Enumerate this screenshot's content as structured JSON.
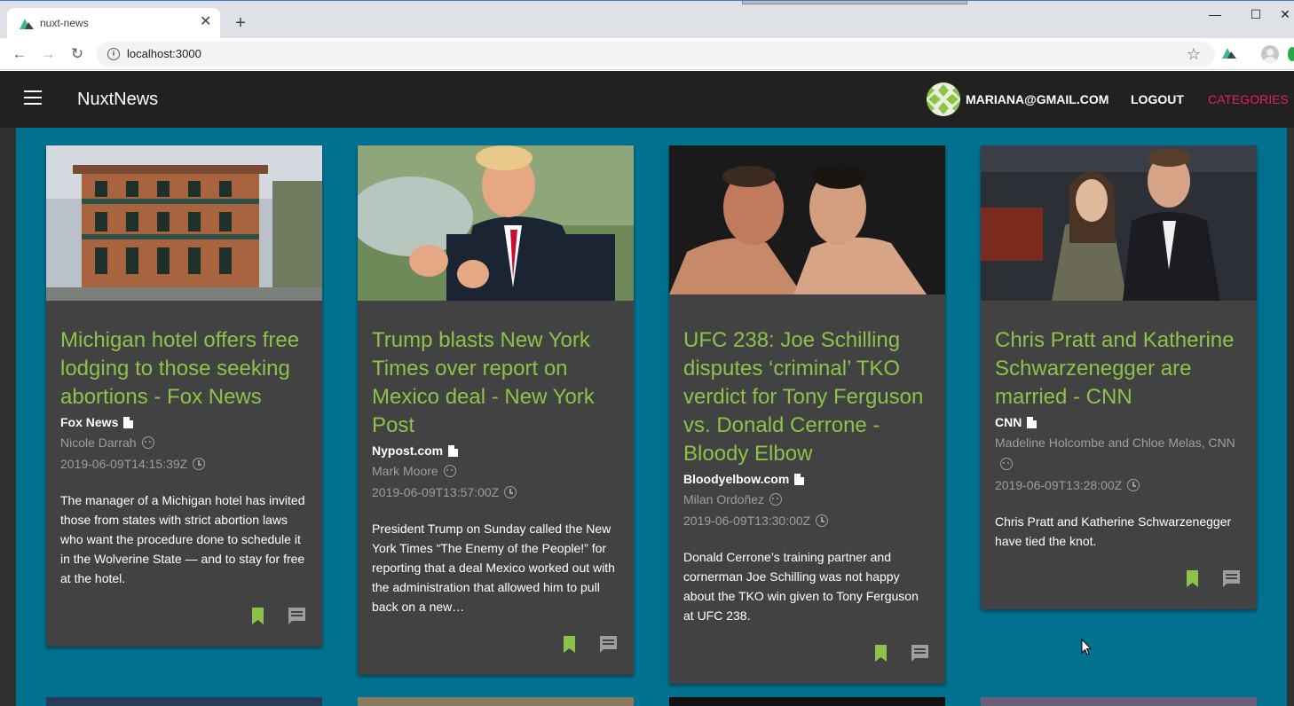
{
  "browser": {
    "tab_title": "nuxt-news",
    "tab_close": "✕",
    "new_tab": "+",
    "url": "localhost:3000",
    "back": "←",
    "forward": "→",
    "reload": "↻",
    "star": "☆",
    "minimize": "—",
    "maximize": "☐",
    "close": "✕",
    "info": "i"
  },
  "appbar": {
    "brand": "NuxtNews",
    "user_email": "MARIANA@GMAIL.COM",
    "logout_label": "LOGOUT",
    "categories_label": "CATEGORIES",
    "categories_color": "#e91e63"
  },
  "colors": {
    "accent_title": "#8bc34a",
    "teal_bg": "#00728f",
    "card_bg": "#424242",
    "appbar_bg": "#212121"
  },
  "articles": [
    {
      "title": "Michigan hotel offers free lodging to those seeking abortions - Fox News",
      "source": "Fox News",
      "author": "Nicole Darrah",
      "published": "2019-06-09T14:15:39Z",
      "description": "The manager of a Michigan hotel has invited those from states with strict abortion laws who want the procedure done to schedule it in the Wolverine State — and to stay for free at the hotel."
    },
    {
      "title": "Trump blasts New York Times over report on Mexico deal - New York Post",
      "source": "Nypost.com",
      "author": "Mark Moore",
      "published": "2019-06-09T13:57:00Z",
      "description": "President Trump on Sunday called the New York Times “The Enemy of the People!” for reporting that a deal Mexico worked out with the administration that allowed him to pull back on a new…"
    },
    {
      "title": "UFC 238: Joe Schilling disputes ‘criminal’ TKO verdict for Tony Ferguson vs. Donald Cerrone - Bloody Elbow",
      "source": "Bloodyelbow.com",
      "author": "Milan Ordoñez",
      "published": "2019-06-09T13:30:00Z",
      "description": "Donald Cerrone’s training partner and cornerman Joe Schilling was not happy about the TKO win given to Tony Ferguson at UFC 238."
    },
    {
      "title": "Chris Pratt and Katherine Schwarzenegger are married - CNN",
      "source": "CNN",
      "author": "Madeline Holcombe and Chloe Melas, CNN",
      "published": "2019-06-09T13:28:00Z",
      "description": "Chris Pratt and Katherine Schwarzenegger have tied the knot."
    }
  ]
}
